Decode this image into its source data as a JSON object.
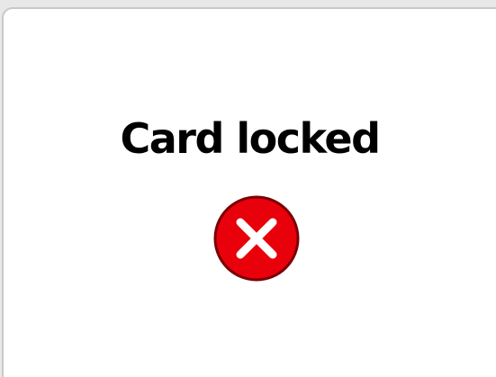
{
  "dialog": {
    "title": "Card locked",
    "status_icon": "error-x-icon",
    "colors": {
      "background": "#ffffff",
      "border": "#c9c9c9",
      "title": "#000000",
      "icon_fill": "#e8000b",
      "icon_outline": "#7a0006",
      "icon_glyph": "#ffffff"
    }
  }
}
